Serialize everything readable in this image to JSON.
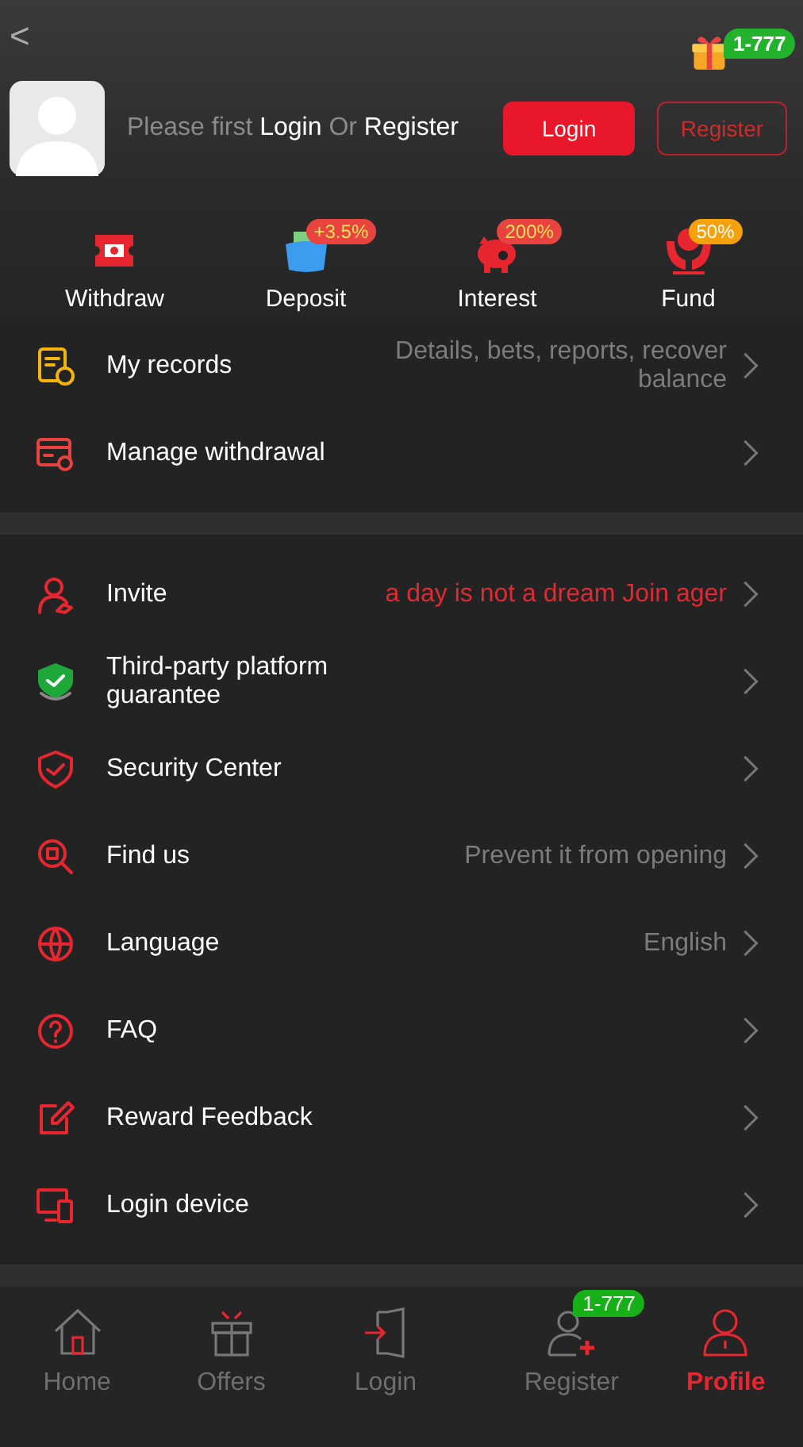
{
  "header": {
    "back": "<",
    "prompt": [
      {
        "text": "Please first ",
        "emphasis": false
      },
      {
        "text": "Login",
        "emphasis": true
      },
      {
        "text": " Or ",
        "emphasis": false
      },
      {
        "text": "Register",
        "emphasis": true
      }
    ],
    "login_button": "Login",
    "register_button": "Register",
    "gift_badge": "1-777"
  },
  "quick_actions": [
    {
      "label": "Withdraw"
    },
    {
      "label": "Deposit",
      "badge": {
        "text": "+3.5%",
        "color": "#e8433f"
      }
    },
    {
      "label": "Interest",
      "badge": {
        "text": "200%",
        "color": "#e8433f"
      }
    },
    {
      "label": "Fund",
      "badge": {
        "text": "50%",
        "color": "#f5a10c"
      }
    }
  ],
  "menu_groups": [
    {
      "items": [
        {
          "label": "My records",
          "detail": "Details, bets, reports, recover balance",
          "detail_highlight": false
        },
        {
          "label": "Manage withdrawal"
        }
      ]
    },
    {
      "items": [
        {
          "label": "Invite",
          "detail": "a day is not a dream  Join ager",
          "detail_highlight": true
        },
        {
          "label": "Third-party platform guarantee"
        },
        {
          "label": "Security Center"
        },
        {
          "label": "Find us",
          "detail": "Prevent it from opening",
          "detail_highlight": false
        },
        {
          "label": "Language",
          "detail": "English",
          "detail_highlight": false
        },
        {
          "label": "FAQ"
        },
        {
          "label": "Reward Feedback"
        },
        {
          "label": "Login device"
        }
      ]
    }
  ],
  "bottom_nav": [
    {
      "label": "Home",
      "selected": false
    },
    {
      "label": "Offers",
      "selected": false
    },
    {
      "label": "Login",
      "selected": false
    },
    {
      "label": "Register",
      "selected": false,
      "badge": "1-777"
    },
    {
      "label": "Profile",
      "selected": true
    }
  ]
}
